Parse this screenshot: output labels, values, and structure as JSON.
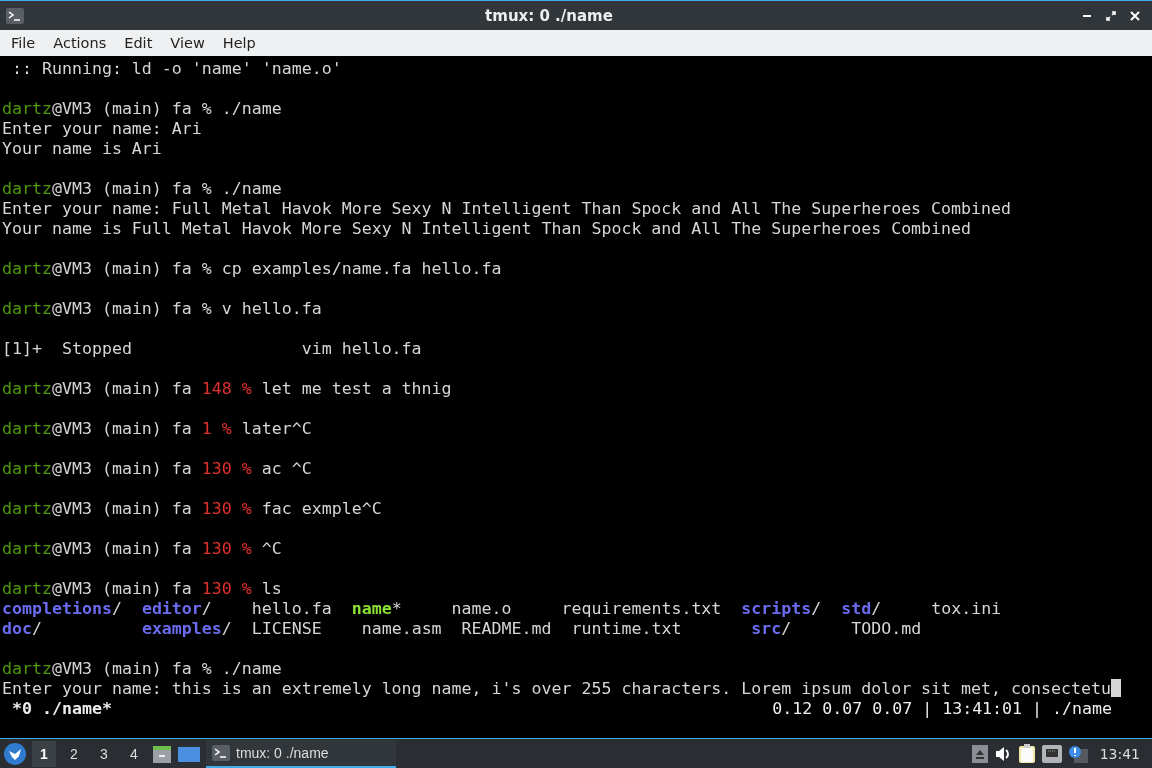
{
  "window": {
    "title": "tmux: 0 ./name"
  },
  "menu": [
    "File",
    "Actions",
    "Edit",
    "View",
    "Help"
  ],
  "terminal": {
    "blocks": [
      {
        "lines": [
          [
            {
              "text": " :: Running: ld -o 'name' 'name.o'",
              "kind": "plain"
            }
          ]
        ]
      },
      {
        "lines": [
          [
            {
              "text": "dartz",
              "kind": "user"
            },
            {
              "text": "@VM3 (main) fa % ./name",
              "kind": "plain"
            }
          ],
          [
            {
              "text": "Enter your name: Ari",
              "kind": "plain"
            }
          ],
          [
            {
              "text": "Your name is Ari",
              "kind": "plain"
            }
          ]
        ]
      },
      {
        "lines": [
          [
            {
              "text": "dartz",
              "kind": "user"
            },
            {
              "text": "@VM3 (main) fa % ./name",
              "kind": "plain"
            }
          ],
          [
            {
              "text": "Enter your name: Full Metal Havok More Sexy N Intelligent Than Spock and All The Superheroes Combined",
              "kind": "plain"
            }
          ],
          [
            {
              "text": "Your name is Full Metal Havok More Sexy N Intelligent Than Spock and All The Superheroes Combined",
              "kind": "plain"
            }
          ]
        ]
      },
      {
        "lines": [
          [
            {
              "text": "dartz",
              "kind": "user"
            },
            {
              "text": "@VM3 (main) fa % cp examples/name.fa hello.fa",
              "kind": "plain"
            }
          ]
        ]
      },
      {
        "lines": [
          [
            {
              "text": "dartz",
              "kind": "user"
            },
            {
              "text": "@VM3 (main) fa % v hello.fa",
              "kind": "plain"
            }
          ]
        ]
      },
      {
        "lines": [
          [
            {
              "text": "[1]+  Stopped                 vim hello.fa",
              "kind": "plain"
            }
          ]
        ]
      },
      {
        "lines": [
          [
            {
              "text": "dartz",
              "kind": "user"
            },
            {
              "text": "@VM3 (main) fa ",
              "kind": "plain"
            },
            {
              "text": "148 %",
              "kind": "error"
            },
            {
              "text": " let me test a thnig",
              "kind": "plain"
            }
          ]
        ]
      },
      {
        "lines": [
          [
            {
              "text": "dartz",
              "kind": "user"
            },
            {
              "text": "@VM3 (main) fa ",
              "kind": "plain"
            },
            {
              "text": "1 %",
              "kind": "error"
            },
            {
              "text": " later^C",
              "kind": "plain"
            }
          ]
        ]
      },
      {
        "lines": [
          [
            {
              "text": "dartz",
              "kind": "user"
            },
            {
              "text": "@VM3 (main) fa ",
              "kind": "plain"
            },
            {
              "text": "130 %",
              "kind": "error"
            },
            {
              "text": " ac ^C",
              "kind": "plain"
            }
          ]
        ]
      },
      {
        "lines": [
          [
            {
              "text": "dartz",
              "kind": "user"
            },
            {
              "text": "@VM3 (main) fa ",
              "kind": "plain"
            },
            {
              "text": "130 %",
              "kind": "error"
            },
            {
              "text": " fac exmple^C",
              "kind": "plain"
            }
          ]
        ]
      },
      {
        "lines": [
          [
            {
              "text": "dartz",
              "kind": "user"
            },
            {
              "text": "@VM3 (main) fa ",
              "kind": "plain"
            },
            {
              "text": "130 %",
              "kind": "error"
            },
            {
              "text": " ^C",
              "kind": "plain"
            }
          ]
        ]
      },
      {
        "lines": [
          [
            {
              "text": "dartz",
              "kind": "user"
            },
            {
              "text": "@VM3 (main) fa ",
              "kind": "plain"
            },
            {
              "text": "130 %",
              "kind": "error"
            },
            {
              "text": " ls",
              "kind": "plain"
            }
          ],
          [
            {
              "text": "completions",
              "kind": "dir"
            },
            {
              "text": "/  ",
              "kind": "plain"
            },
            {
              "text": "editor",
              "kind": "dir"
            },
            {
              "text": "/    hello.fa  ",
              "kind": "plain"
            },
            {
              "text": "name",
              "kind": "exec"
            },
            {
              "text": "*     name.o     requirements.txt  ",
              "kind": "plain"
            },
            {
              "text": "scripts",
              "kind": "dir"
            },
            {
              "text": "/  ",
              "kind": "plain"
            },
            {
              "text": "std",
              "kind": "dir"
            },
            {
              "text": "/     tox.ini",
              "kind": "plain"
            }
          ],
          [
            {
              "text": "doc",
              "kind": "dir"
            },
            {
              "text": "/          ",
              "kind": "plain"
            },
            {
              "text": "examples",
              "kind": "dir"
            },
            {
              "text": "/  LICENSE    name.asm  README.md  runtime.txt       ",
              "kind": "plain"
            },
            {
              "text": "src",
              "kind": "dir"
            },
            {
              "text": "/      TODO.md",
              "kind": "plain"
            }
          ]
        ]
      },
      {
        "lines": [
          [
            {
              "text": "dartz",
              "kind": "user"
            },
            {
              "text": "@VM3 (main) fa % ./name",
              "kind": "plain"
            }
          ],
          [
            {
              "text": "Enter your name: this is an extremely long name, i's over 255 characters. Lorem ipsum dolor sit met, consectetu",
              "kind": "plain"
            }
          ]
        ]
      }
    ]
  },
  "tmux_status": {
    "left": " *0 ./name*",
    "right": "0.12 0.07 0.07 | 13:41:01 | ./name"
  },
  "taskbar": {
    "workspaces": [
      {
        "label": "1",
        "selected": true
      },
      {
        "label": "2",
        "selected": false
      },
      {
        "label": "3",
        "selected": false
      },
      {
        "label": "4",
        "selected": false
      }
    ],
    "task": {
      "label": "tmux: 0 ./name",
      "selected": true
    },
    "clock": "13:41"
  }
}
